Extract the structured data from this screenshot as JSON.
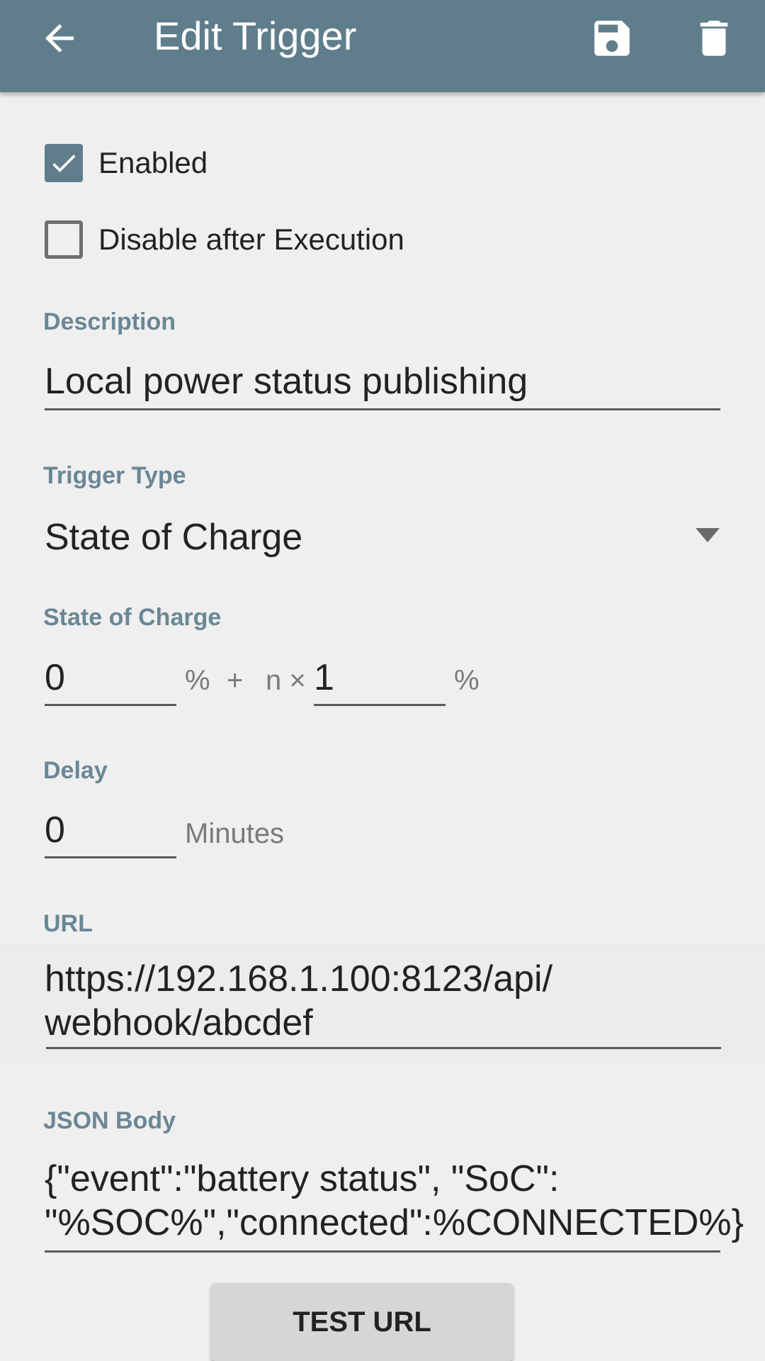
{
  "appbar": {
    "title": "Edit Trigger",
    "bg": "#607d8b"
  },
  "checkboxes": {
    "enabled": {
      "label": "Enabled",
      "checked": true
    },
    "disable_after": {
      "label": "Disable after Execution",
      "checked": false
    }
  },
  "description": {
    "label": "Description",
    "value": "Local power status publishing"
  },
  "trigger_type": {
    "label": "Trigger Type",
    "value": "State of Charge"
  },
  "soc": {
    "label": "State of Charge",
    "start": "0",
    "unit1": "%",
    "plus": "+",
    "n_times": "n ×",
    "step": "1",
    "unit2": "%"
  },
  "delay": {
    "label": "Delay",
    "value": "0",
    "unit": "Minutes"
  },
  "url": {
    "label": "URL",
    "line1": "https://192.168.1.100:8123/api/",
    "line2": "webhook/abcdef"
  },
  "json_body": {
    "label": "JSON Body",
    "line1": "{\"event\":\"battery status\", \"SoC\":",
    "line2": "\"%SOC%\",\"connected\":%CONNECTED%}"
  },
  "test_button": {
    "label": "TEST URL"
  },
  "icons": [
    "back-arrow-icon",
    "save-icon",
    "delete-icon",
    "checkmark-icon",
    "dropdown-arrow-icon"
  ]
}
